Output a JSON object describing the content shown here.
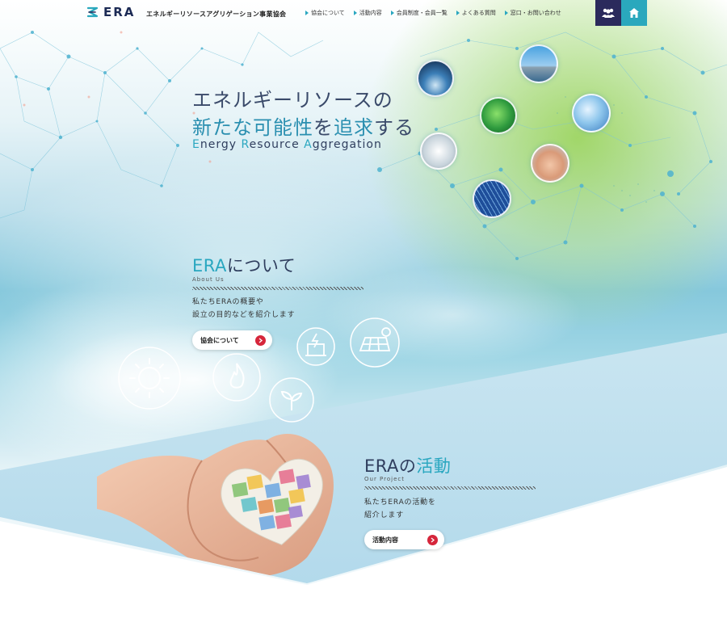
{
  "header": {
    "logo_text": "ERA",
    "org_name": "エネルギーリソースアグリゲーション事業協会",
    "nav": [
      {
        "label": "協会について"
      },
      {
        "label": "活動内容"
      },
      {
        "label": "会員制度・会員一覧"
      },
      {
        "label": "よくある質問"
      },
      {
        "label": "窓口・お問い合わせ"
      }
    ],
    "members_icon": "members-icon",
    "home_icon": "home-icon"
  },
  "hero": {
    "title_line1": "エネルギーリソースの",
    "title_line2_accent1": "新たな可能性",
    "title_line2_mid": "を",
    "title_line2_accent2": "追求",
    "title_line2_end": "する",
    "subtitle_parts": [
      "E",
      "nergy ",
      "R",
      "esource ",
      "A",
      "ggregation"
    ]
  },
  "about": {
    "title_prefix": "ERA",
    "title_suffix": "について",
    "subtitle": "About Us",
    "desc_line1": "私たちERAの概要や",
    "desc_line2": "設立の目的などを紹介します",
    "button_label": "協会について"
  },
  "project": {
    "title_prefix": "ERAの",
    "title_suffix": "活動",
    "subtitle": "Our Project",
    "desc_line1": "私たちERAの活動を",
    "desc_line2": "紹介します",
    "button_label": "活動内容"
  },
  "colors": {
    "navy": "#2b2a5c",
    "teal": "#2aa8bd",
    "accent_red": "#d6263b",
    "heading": "#2f3e5e"
  },
  "icons": [
    "sun-icon",
    "flame-icon",
    "sprout-icon",
    "battery-icon",
    "solar-panel-icon"
  ]
}
